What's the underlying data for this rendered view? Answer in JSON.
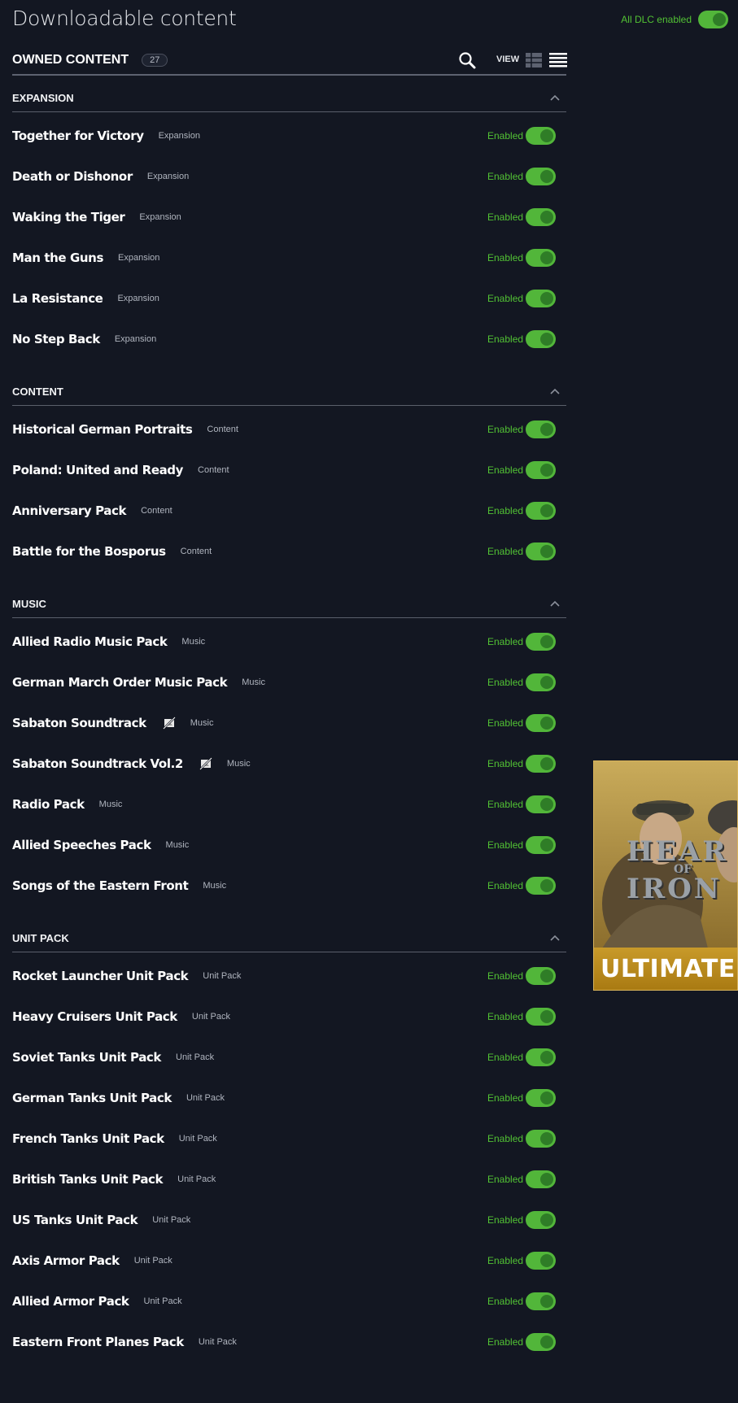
{
  "header": {
    "title": "Downloadable content",
    "all_dlc_label": "All DLC enabled"
  },
  "owned": {
    "title": "OWNED CONTENT",
    "count": "27",
    "view_label": "VIEW"
  },
  "status_label": "Enabled",
  "colors": {
    "accent": "#52c234",
    "background": "#131722",
    "toggle_on": "#52b63a"
  },
  "sections": [
    {
      "title": "EXPANSION",
      "items": [
        {
          "name": "Together for Victory",
          "category": "Expansion"
        },
        {
          "name": "Death or Dishonor",
          "category": "Expansion"
        },
        {
          "name": "Waking the Tiger",
          "category": "Expansion"
        },
        {
          "name": "Man the Guns",
          "category": "Expansion"
        },
        {
          "name": "La Resistance",
          "category": "Expansion"
        },
        {
          "name": "No Step Back",
          "category": "Expansion"
        }
      ]
    },
    {
      "title": "CONTENT",
      "items": [
        {
          "name": "Historical German Portraits",
          "category": "Content"
        },
        {
          "name": "Poland: United and Ready",
          "category": "Content"
        },
        {
          "name": "Anniversary Pack",
          "category": "Content"
        },
        {
          "name": "Battle for the Bosporus",
          "category": "Content"
        }
      ]
    },
    {
      "title": "MUSIC",
      "items": [
        {
          "name": "Allied Radio Music Pack",
          "category": "Music"
        },
        {
          "name": "German March Order Music Pack",
          "category": "Music"
        },
        {
          "name": "Sabaton Soundtrack",
          "category": "Music",
          "icon": "streaming-disabled-icon"
        },
        {
          "name": "Sabaton Soundtrack Vol.2",
          "category": "Music",
          "icon": "streaming-disabled-icon"
        },
        {
          "name": "Radio Pack",
          "category": "Music"
        },
        {
          "name": "Allied Speeches Pack",
          "category": "Music"
        },
        {
          "name": "Songs of the Eastern Front",
          "category": "Music"
        }
      ]
    },
    {
      "title": "UNIT PACK",
      "items": [
        {
          "name": "Rocket Launcher Unit Pack",
          "category": "Unit Pack"
        },
        {
          "name": "Heavy Cruisers Unit Pack",
          "category": "Unit Pack"
        },
        {
          "name": "Soviet Tanks Unit Pack",
          "category": "Unit Pack"
        },
        {
          "name": "German Tanks Unit Pack",
          "category": "Unit Pack"
        },
        {
          "name": "French Tanks Unit Pack",
          "category": "Unit Pack"
        },
        {
          "name": "British Tanks Unit Pack",
          "category": "Unit Pack"
        },
        {
          "name": "US Tanks Unit Pack",
          "category": "Unit Pack"
        },
        {
          "name": "Axis Armor Pack",
          "category": "Unit Pack"
        },
        {
          "name": "Allied Armor Pack",
          "category": "Unit Pack"
        },
        {
          "name": "Eastern Front Planes Pack",
          "category": "Unit Pack"
        }
      ]
    }
  ],
  "promo": {
    "logo_line1": "HEAR",
    "logo_line2": "OF",
    "logo_line3": "IRON",
    "banner": "ULTIMATE B"
  }
}
